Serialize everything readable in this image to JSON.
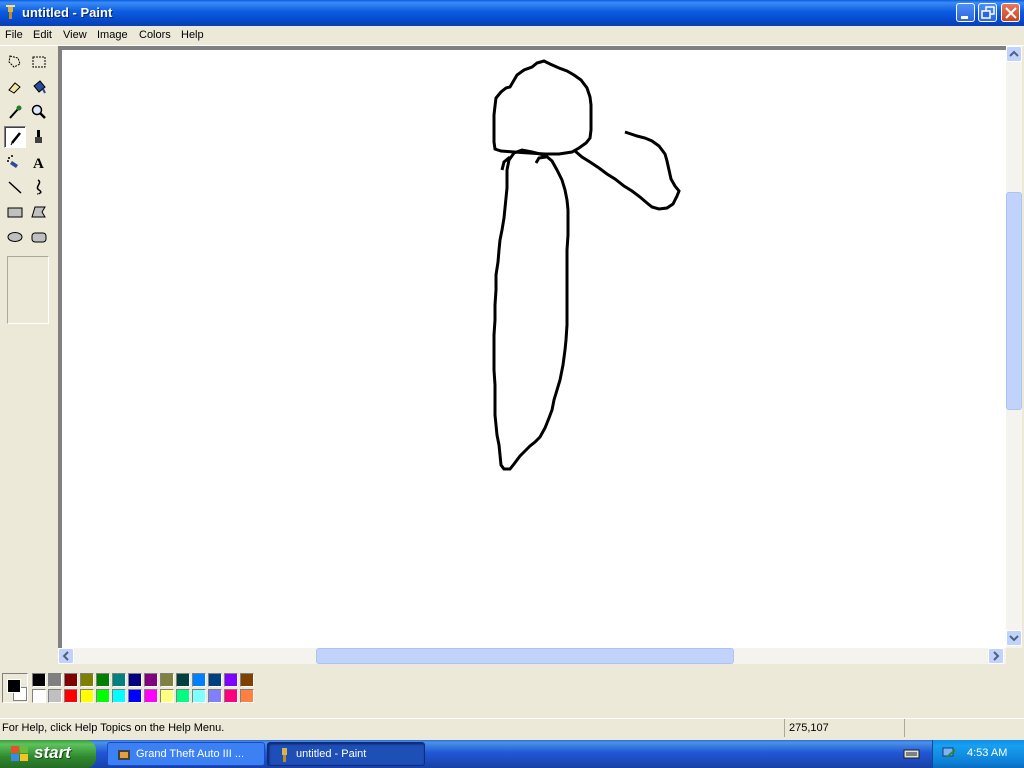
{
  "window": {
    "title": "untitled - Paint",
    "controls": {
      "minimize": "minimize",
      "restore": "restore",
      "close": "close"
    }
  },
  "menu": {
    "items": [
      "File",
      "Edit",
      "View",
      "Image",
      "Colors",
      "Help"
    ]
  },
  "toolbox": {
    "tools": [
      "free-form-select-icon",
      "select-icon",
      "eraser-icon",
      "fill-icon",
      "pick-color-icon",
      "magnifier-icon",
      "pencil-icon",
      "brush-icon",
      "airbrush-icon",
      "text-icon",
      "line-icon",
      "curve-icon",
      "rectangle-icon",
      "polygon-icon",
      "ellipse-icon",
      "rounded-rectangle-icon"
    ],
    "selected": "pencil-icon",
    "text_tool_glyph": "A"
  },
  "palette": {
    "foreground": "#000000",
    "background": "#ffffff",
    "colors_top": [
      "#000000",
      "#808080",
      "#800000",
      "#808000",
      "#008000",
      "#008080",
      "#000080",
      "#800080",
      "#808040",
      "#004040",
      "#0080ff",
      "#004080",
      "#8000ff",
      "#804000"
    ],
    "colors_bottom": [
      "#ffffff",
      "#c0c0c0",
      "#ff0000",
      "#ffff00",
      "#00ff00",
      "#00ffff",
      "#0000ff",
      "#ff00ff",
      "#ffff80",
      "#00ff80",
      "#80ffff",
      "#8080ff",
      "#ff0080",
      "#ff8040"
    ]
  },
  "statusbar": {
    "help_text": "For Help, click Help Topics on the Help Menu.",
    "coordinates": "275,107"
  },
  "taskbar": {
    "start_label": "start",
    "items": [
      {
        "label": "Grand Theft Auto III ...",
        "active": false
      },
      {
        "label": "untitled - Paint",
        "active": true
      }
    ],
    "clock": "4:53 AM"
  }
}
